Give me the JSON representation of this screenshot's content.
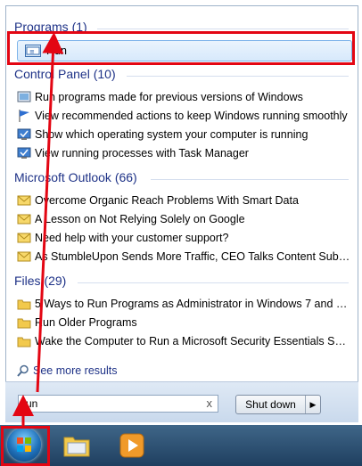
{
  "sections": {
    "programs": {
      "header": "Programs (1)",
      "items": [
        "Run"
      ]
    },
    "control_panel": {
      "header": "Control Panel (10)",
      "items": [
        "Run programs made for previous versions of Windows",
        "View recommended actions to keep Windows running smoothly",
        "Show which operating system your computer is running",
        "View running processes with Task Manager"
      ]
    },
    "outlook": {
      "header": "Microsoft Outlook (66)",
      "items": [
        "Overcome Organic Reach Problems With Smart Data",
        "A Lesson on Not Relying Solely on Google",
        "Need help with your customer support?",
        "As StumbleUpon Sends More Traffic, CEO Talks Content Submi..."
      ]
    },
    "files": {
      "header": "Files (29)",
      "items": [
        "5 Ways to Run Programs as Administrator in Windows 7 and Wi...",
        "Run Older Programs",
        "Wake the Computer to Run a Microsoft Security Essentials Scan"
      ]
    }
  },
  "see_more": "See more results",
  "search": {
    "value": "run",
    "clear": "x"
  },
  "shutdown": {
    "label": "Shut down",
    "arrow": "▶"
  },
  "colors": {
    "annotation": "#e30613",
    "header_text": "#1e3287"
  }
}
